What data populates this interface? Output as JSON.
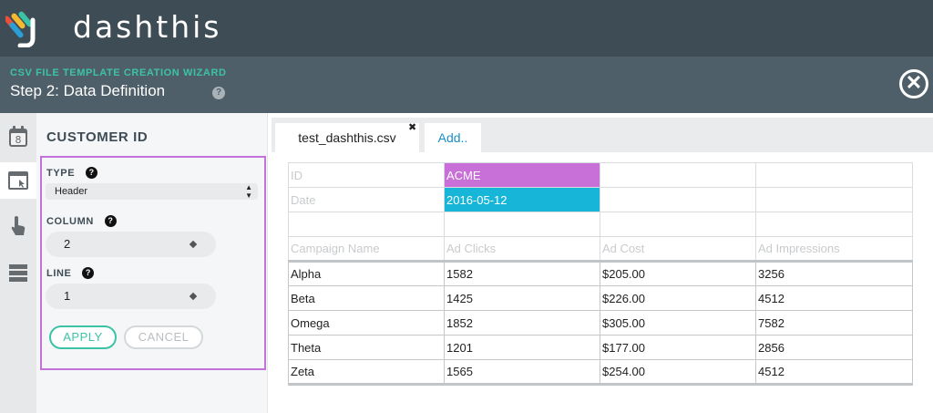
{
  "app": {
    "brand": "dashthis",
    "colors": {
      "accent": "#3cc3a7",
      "highlight_purple": "#c96fd8",
      "highlight_cyan": "#17b6d9",
      "header_bg": "#3e4c56"
    }
  },
  "wizard": {
    "title": "CSV FILE TEMPLATE CREATION WIZARD",
    "step": "Step 2: Data Definition",
    "help": "?",
    "close": "✕"
  },
  "rail": [
    "calendar-icon",
    "window-cursor-icon",
    "pointer-hand-icon",
    "table-rows-icon"
  ],
  "rail_calendar_day": "8",
  "panel": {
    "title": "CUSTOMER ID",
    "type_label": "TYPE",
    "type_value": "Header",
    "column_label": "COLUMN",
    "column_value": "2",
    "line_label": "LINE",
    "line_value": "1",
    "apply": "APPLY",
    "cancel": "CANCEL",
    "help": "?"
  },
  "tabs": {
    "active": "test_dashthis.csv",
    "close": "✖",
    "add": "Add.."
  },
  "sheet": {
    "meta": [
      [
        "ID",
        "ACME",
        "",
        ""
      ],
      [
        "Date",
        "2016-05-12",
        "",
        ""
      ],
      [
        "",
        "",
        "",
        ""
      ]
    ],
    "headers": [
      "Campaign Name",
      "Ad Clicks",
      "Ad Cost",
      "Ad Impressions"
    ],
    "rows": [
      [
        "Alpha",
        "1582",
        "$205.00",
        "3256"
      ],
      [
        "Beta",
        "1425",
        "$226.00",
        "4512"
      ],
      [
        "Omega",
        "1852",
        "$305.00",
        "7582"
      ],
      [
        "Theta",
        "1201",
        "$177.00",
        "2856"
      ],
      [
        "Zeta",
        "1565",
        "$254.00",
        "4512"
      ]
    ]
  }
}
